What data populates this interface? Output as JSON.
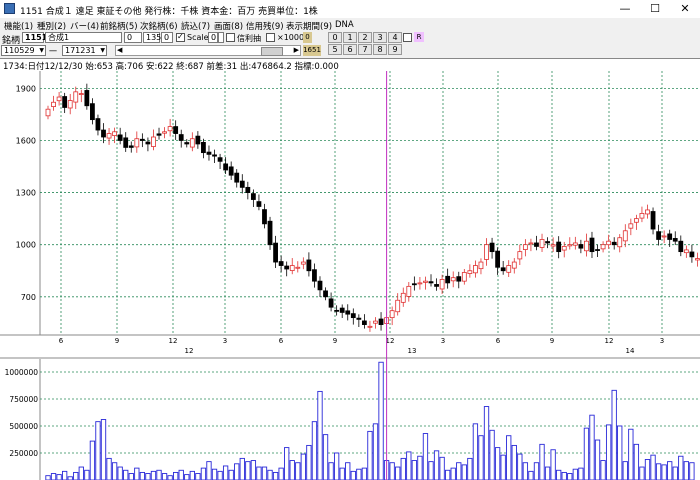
{
  "window": {
    "title": "1151 合成１ 遠足 東証その他 発行株：千株 資本金：百万 売買単位：1株",
    "minimize": "—",
    "maximize": "☐",
    "close": "✕"
  },
  "menu": [
    "機能(1)",
    "種別(2)",
    "バー(4)",
    "前銘柄(5)",
    "次銘柄(6)",
    "読込(7)",
    "画面(8)",
    "信用残(9)",
    "表示期間(9)",
    "DNA"
  ],
  "toolbar": {
    "code_label": "銘柄",
    "code": "1151",
    "name": "合成1",
    "field_a": "0",
    "field_b": "1350",
    "field_c": "0",
    "scale_label": "Scale",
    "field_d": "0",
    "credit_label": "信利抽",
    "x1000_label": "×1000",
    "badge_zero": "0",
    "badge_r": "R",
    "num_buttons_row1": [
      "0",
      "1",
      "2",
      "3",
      "4"
    ],
    "num_buttons_row2": [
      "5",
      "6",
      "7",
      "8",
      "9"
    ],
    "start_date": "110529",
    "dash": "一",
    "end_date": "171231",
    "count_badge": "1651"
  },
  "info": "1734:日付12/12/30 始:653 高:706 安:622 終:687 前差:31 出:476864.2 指標:0.000",
  "chart_data": [
    {
      "type": "candlestick",
      "y_ticks": [
        "1900",
        "1600",
        "1300",
        "1000",
        "700"
      ],
      "y_tick_values": [
        1900,
        1600,
        1300,
        1000,
        700
      ],
      "x_ticks": [
        "6",
        "9",
        "12",
        "3",
        "6",
        "9",
        "12",
        "3",
        "6",
        "9",
        "12",
        "3"
      ],
      "year_labels": [
        "12",
        "13",
        "14"
      ],
      "ylim": [
        480,
        2000
      ],
      "grid": true,
      "closes": [
        1780,
        1820,
        1850,
        1790,
        1830,
        1880,
        1870,
        1800,
        1720,
        1660,
        1620,
        1640,
        1650,
        1600,
        1560,
        1560,
        1610,
        1600,
        1580,
        1620,
        1630,
        1650,
        1680,
        1640,
        1600,
        1580,
        1610,
        1580,
        1530,
        1520,
        1510,
        1480,
        1430,
        1400,
        1360,
        1330,
        1300,
        1260,
        1220,
        1120,
        1000,
        900,
        880,
        860,
        880,
        870,
        900,
        850,
        790,
        740,
        700,
        640,
        620,
        610,
        600,
        580,
        570,
        540,
        530,
        560,
        540,
        580,
        620,
        680,
        720,
        760,
        770,
        780,
        790,
        780,
        760,
        800,
        780,
        810,
        790,
        840,
        850,
        880,
        900,
        1000,
        960,
        870,
        850,
        880,
        900,
        960,
        1000,
        1010,
        990,
        1030,
        1010,
        1000,
        960,
        990,
        1000,
        1010,
        980,
        1020,
        960,
        970,
        1000,
        1020,
        1000,
        1040,
        1080,
        1120,
        1150,
        1180,
        1200,
        1090,
        1030,
        1050,
        1030,
        1020,
        960,
        970,
        930,
        920
      ],
      "volume_ticks": [
        "1000000",
        "750000",
        "500000",
        "250000"
      ],
      "volume_tick_values": [
        1000000,
        750000,
        500000,
        250000
      ],
      "vlim": [
        0,
        1120000
      ],
      "volumes": [
        40000,
        60000,
        50000,
        80000,
        30000,
        70000,
        120000,
        90000,
        360000,
        540000,
        560000,
        200000,
        160000,
        120000,
        90000,
        60000,
        110000,
        70000,
        60000,
        80000,
        90000,
        60000,
        40000,
        70000,
        90000,
        50000,
        80000,
        60000,
        110000,
        170000,
        100000,
        80000,
        130000,
        90000,
        150000,
        200000,
        170000,
        180000,
        120000,
        120000,
        90000,
        70000,
        110000,
        300000,
        180000,
        160000,
        240000,
        320000,
        540000,
        820000,
        420000,
        160000,
        250000,
        110000,
        160000,
        80000,
        100000,
        110000,
        450000,
        520000,
        1090000,
        180000,
        160000,
        120000,
        200000,
        260000,
        180000,
        220000,
        430000,
        170000,
        270000,
        210000,
        90000,
        110000,
        160000,
        140000,
        200000,
        520000,
        410000,
        680000,
        460000,
        300000,
        230000,
        410000,
        320000,
        240000,
        160000,
        80000,
        160000,
        330000,
        120000,
        280000,
        90000,
        70000,
        60000,
        100000,
        110000,
        480000,
        600000,
        370000,
        180000,
        510000,
        830000,
        500000,
        170000,
        470000,
        330000,
        120000,
        190000,
        230000,
        150000,
        140000,
        170000,
        120000,
        220000,
        170000,
        160000
      ],
      "cursor_index": 61
    }
  ]
}
